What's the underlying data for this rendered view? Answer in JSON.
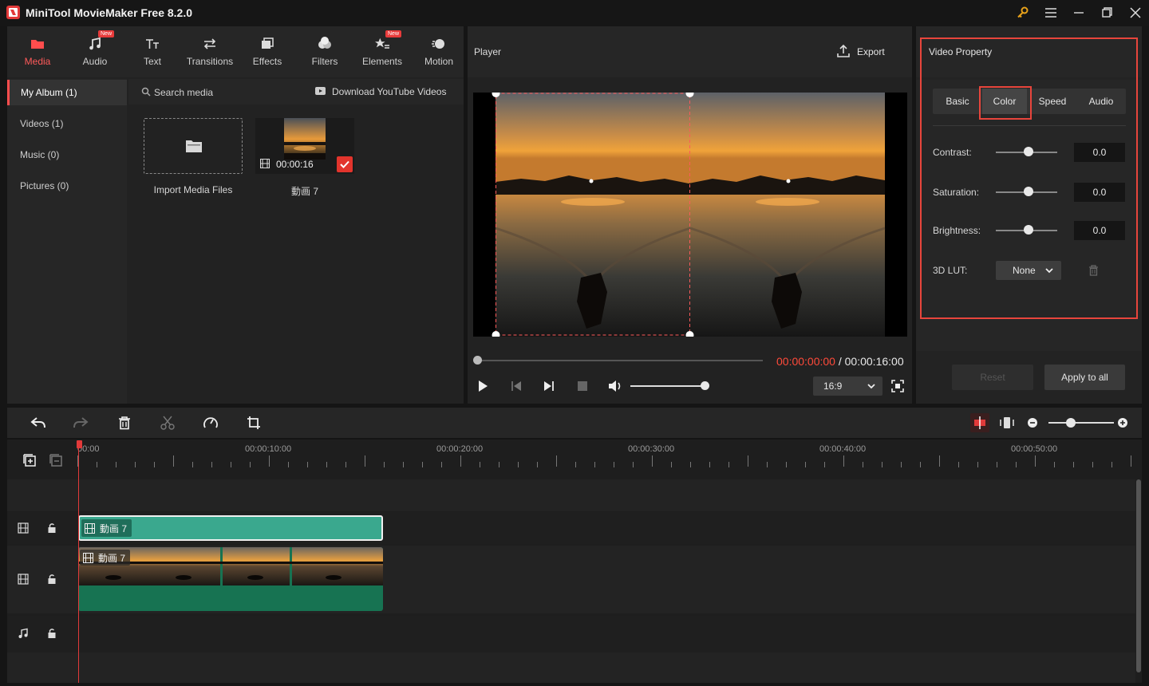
{
  "window": {
    "title": "MiniTool MovieMaker Free 8.2.0"
  },
  "media_tabs": [
    {
      "label": "Media",
      "icon": "folder-icon",
      "active": true,
      "badge": ""
    },
    {
      "label": "Audio",
      "icon": "music-note-icon",
      "active": false,
      "badge": "New"
    },
    {
      "label": "Text",
      "icon": "text-icon",
      "active": false,
      "badge": ""
    },
    {
      "label": "Transitions",
      "icon": "transition-arrows-icon",
      "active": false,
      "badge": ""
    },
    {
      "label": "Effects",
      "icon": "effects-icon",
      "active": false,
      "badge": ""
    },
    {
      "label": "Filters",
      "icon": "filters-icon",
      "active": false,
      "badge": ""
    },
    {
      "label": "Elements",
      "icon": "elements-icon",
      "active": false,
      "badge": "New"
    },
    {
      "label": "Motion",
      "icon": "motion-icon",
      "active": false,
      "badge": ""
    }
  ],
  "album": {
    "items": [
      {
        "label": "My Album (1)",
        "active": true
      },
      {
        "label": "Videos (1)",
        "active": false
      },
      {
        "label": "Music (0)",
        "active": false
      },
      {
        "label": "Pictures (0)",
        "active": false
      }
    ]
  },
  "media": {
    "search_label": "Search media",
    "download_label": "Download YouTube Videos",
    "import_label": "Import Media Files",
    "clip_name": "動画 7",
    "clip_duration": "00:00:16"
  },
  "player": {
    "title": "Player",
    "export_label": "Export",
    "current_time": "00:00:00:00",
    "separator": " / ",
    "total_time": "00:00:16:00",
    "aspect_ratio": "16:9",
    "progress": 0,
    "volume": 1.0
  },
  "properties": {
    "title": "Video Property",
    "tabs": [
      "Basic",
      "Color",
      "Speed",
      "Audio"
    ],
    "active_tab": "Color",
    "contrast_label": "Contrast:",
    "contrast_value": "0.0",
    "saturation_label": "Saturation:",
    "saturation_value": "0.0",
    "brightness_label": "Brightness:",
    "brightness_value": "0.0",
    "lut_label": "3D LUT:",
    "lut_value": "None",
    "reset_label": "Reset",
    "apply_all_label": "Apply to all"
  },
  "timeline": {
    "ruler_labels": [
      "00:00",
      "00:00:10:00",
      "00:00:20:00",
      "00:00:30:00",
      "00:00:40:00",
      "00:00:50:00"
    ],
    "clip_label": "動画 7",
    "clip_label_video": "動画 7"
  },
  "colors": {
    "accent": "#ff4d4d",
    "highlight": "#e8453c",
    "clip_teal": "#3aa88e",
    "clip_green": "#177352"
  }
}
